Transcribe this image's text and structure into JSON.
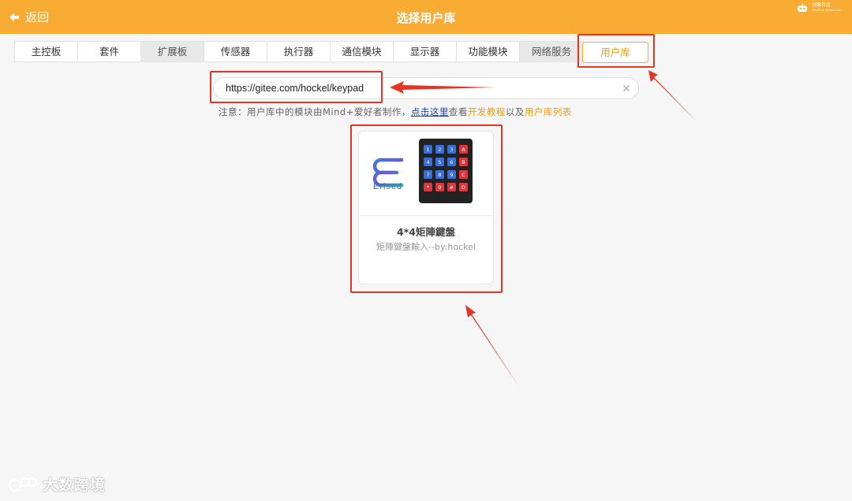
{
  "header": {
    "back_label": "返回",
    "title": "选择用户库",
    "brand_name": "创客社区",
    "brand_sub": "MindPlus Community"
  },
  "tabs": [
    {
      "label": "主控板",
      "style": "white"
    },
    {
      "label": "套件",
      "style": "white"
    },
    {
      "label": "扩展板",
      "style": "grey"
    },
    {
      "label": "传感器",
      "style": "white"
    },
    {
      "label": "执行器",
      "style": "white"
    },
    {
      "label": "通信模块",
      "style": "white"
    },
    {
      "label": "显示器",
      "style": "white"
    },
    {
      "label": "功能模块",
      "style": "white"
    },
    {
      "label": "网络服务",
      "style": "grey"
    }
  ],
  "active_tab": {
    "label": "用户库"
  },
  "search": {
    "value": "https://gitee.com/hockel/keypad"
  },
  "notice": {
    "prefix": "注意：用户库中的模块由Mind+爱好者制作，",
    "link": "点击这里",
    "mid1": "查看",
    "tutorial": "开发教程",
    "mid2": "以及",
    "list": "用户库列表"
  },
  "card": {
    "logo_word": "Erised",
    "title": "4*4矩陣鍵盤",
    "desc": "矩陣鍵盤輸入--by:hockel",
    "keypad_keys": [
      "1",
      "2",
      "3",
      "A",
      "4",
      "5",
      "6",
      "B",
      "7",
      "8",
      "9",
      "C",
      "*",
      "0",
      "#",
      "D"
    ]
  },
  "watermark": {
    "text": "大数跨境"
  },
  "colors": {
    "header": "#f8ac33",
    "accent": "#f39c12",
    "highlight": "#e53424",
    "link": "#1a3fd1",
    "key_blue": "#3c6fd6",
    "key_red": "#d8373c"
  }
}
